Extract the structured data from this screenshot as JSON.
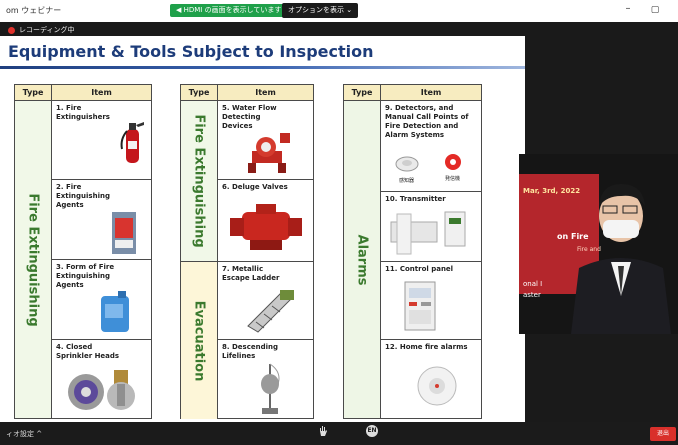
{
  "window": {
    "title": "om ウェビナー",
    "share_banner": "◀ HDMI の画面を表示しています",
    "options_label": "オプションを表示 ⌄",
    "minimize_glyph": "–",
    "restore_glyph": "▢"
  },
  "recording": {
    "label": "レコーディング中"
  },
  "slide": {
    "title": "Equipment & Tools Subject to Inspection",
    "tables": [
      {
        "type_header": "Type",
        "item_header": "Item",
        "groups": [
          {
            "type": "Fire Extinguishing",
            "items": [
              {
                "label": "1. Fire Extinguishers"
              },
              {
                "label": "2. Fire Extinguishing Agents"
              },
              {
                "label": "3. Form of Fire Extinguishing Agents"
              },
              {
                "label": "4. Closed Sprinkler Heads"
              }
            ]
          }
        ]
      },
      {
        "type_header": "Type",
        "item_header": "Item",
        "groups": [
          {
            "type": "Fire Extinguishing",
            "items": [
              {
                "label": "5. Water Flow Detecting Devices"
              },
              {
                "label": "6. Deluge Valves"
              }
            ]
          },
          {
            "type": "Evacuation",
            "items": [
              {
                "label": "7. Metallic Escape Ladder"
              },
              {
                "label": "8. Descending Lifelines"
              }
            ]
          }
        ]
      },
      {
        "type_header": "Type",
        "item_header": "Item",
        "groups": [
          {
            "type": "Alarms",
            "items": [
              {
                "label": "9. Detectors, and Manual Call Points of Fire Detection and Alarm Systems",
                "captions": [
                  "感知器",
                  "発信機"
                ]
              },
              {
                "label": "10. Transmitter"
              },
              {
                "label": "11. Control panel"
              },
              {
                "label": "12. Home fire alarms"
              }
            ]
          }
        ]
      }
    ]
  },
  "camera": {
    "date_text": "Mar, 3rd, 2022",
    "banner_line1": "on Fire",
    "banner_line2": "Fire and",
    "banner_line3": "onal I",
    "banner_line4": "aster"
  },
  "bottom_bar": {
    "left_label": "ィオ設定 ^",
    "end_label": "退出",
    "language_badge": "EN"
  },
  "colors": {
    "accent_title": "#1d3c7a",
    "type_label_green": "#3b7a2e",
    "header_fill": "#f7ecc0",
    "share_green": "#1fa04a",
    "end_red": "#d9302b"
  }
}
